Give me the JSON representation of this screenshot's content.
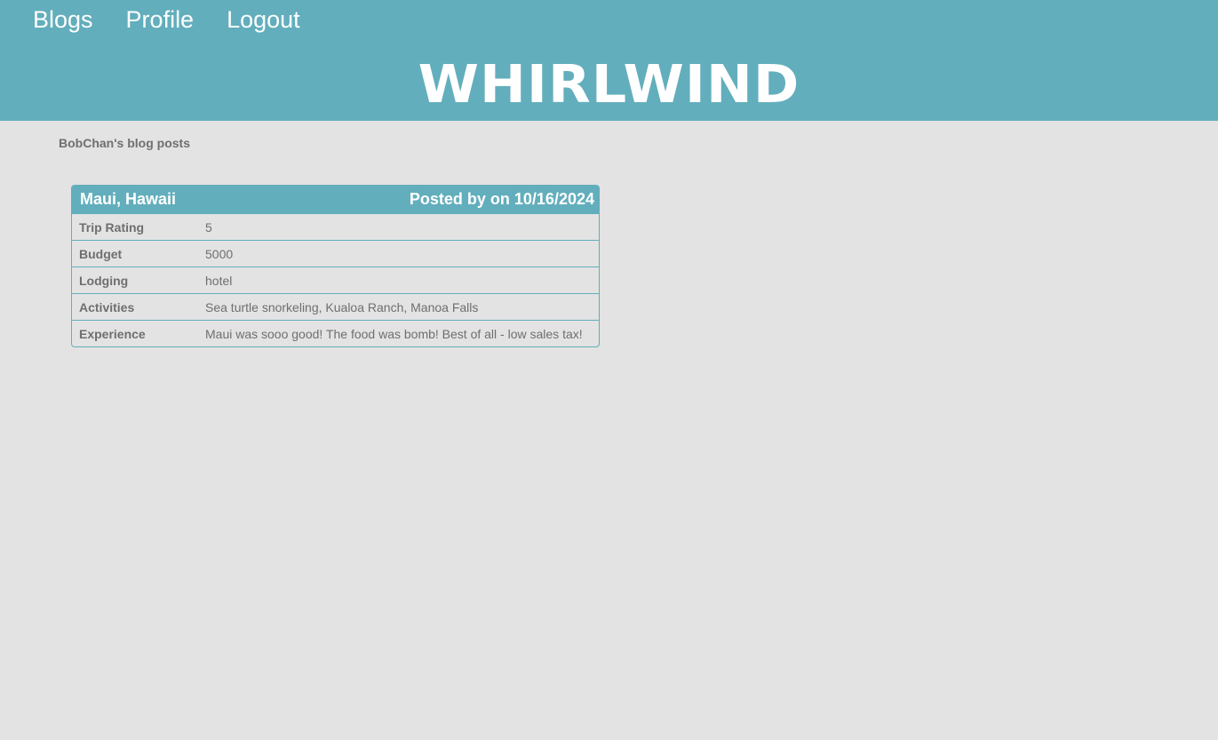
{
  "nav": {
    "items": [
      {
        "label": "Blogs"
      },
      {
        "label": "Profile"
      },
      {
        "label": "Logout"
      }
    ]
  },
  "brand": {
    "title": "WHIRLWIND"
  },
  "page": {
    "heading": "BobChan's blog posts"
  },
  "post": {
    "title": "Maui, Hawaii",
    "posted": "Posted by on 10/16/2024",
    "rows": [
      {
        "label": "Trip Rating",
        "value": "5"
      },
      {
        "label": "Budget",
        "value": "5000"
      },
      {
        "label": "Lodging",
        "value": "hotel"
      },
      {
        "label": "Activities",
        "value": "Sea turtle snorkeling, Kualoa Ranch, Manoa Falls"
      },
      {
        "label": "Experience",
        "value": "Maui was sooo good! The food was bomb! Best of all - low sales tax!"
      }
    ]
  },
  "colors": {
    "accent": "#62aebc",
    "background": "#e3e3e3",
    "text": "#6f6f6f"
  }
}
